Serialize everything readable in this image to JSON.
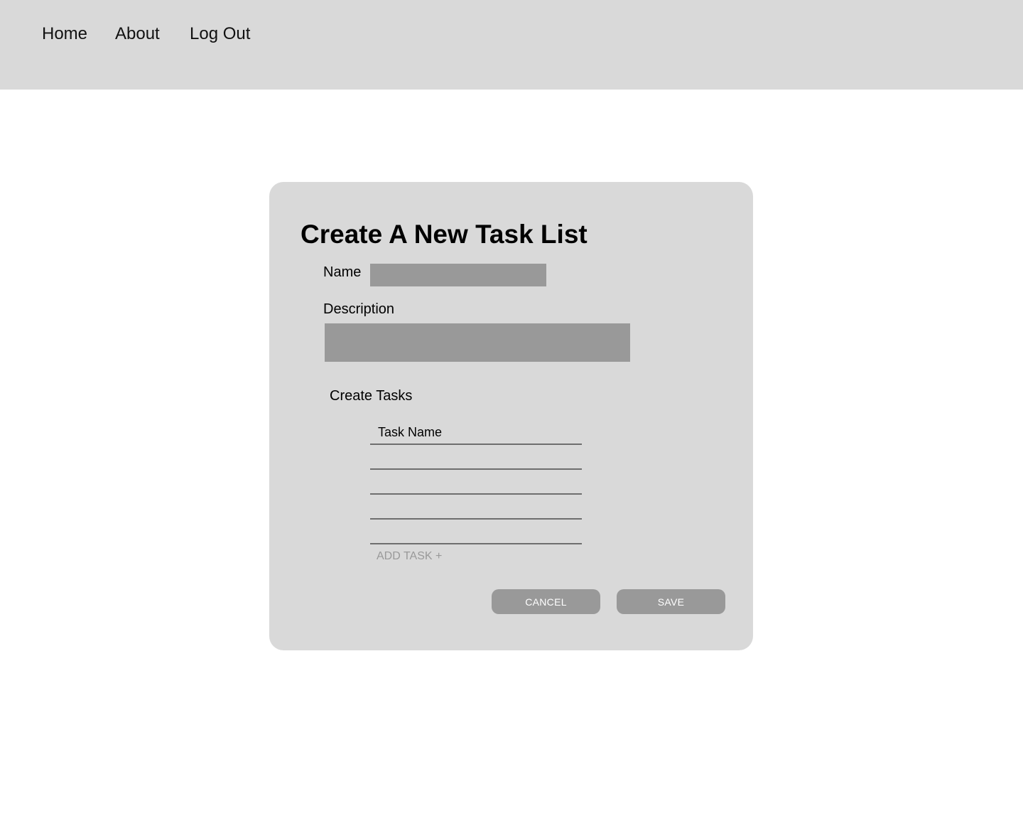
{
  "nav": {
    "home": "Home",
    "about": "About",
    "logout": "Log Out"
  },
  "form": {
    "title": "Create A New Task List",
    "name_label": "Name",
    "name_value": "",
    "description_label": "Description",
    "description_value": "",
    "tasks_label": "Create Tasks",
    "task_placeholder": "Task Name",
    "tasks": [
      "",
      "",
      "",
      "",
      ""
    ],
    "add_task": "ADD TASK +",
    "cancel": "CANCEL",
    "save": "SAVE"
  },
  "colors": {
    "header_bg": "#d9d9d9",
    "card_bg": "#d9d9d9",
    "field_bg": "#999999",
    "button_bg": "#999999",
    "button_text": "#ffffff",
    "muted_text": "#999999"
  }
}
